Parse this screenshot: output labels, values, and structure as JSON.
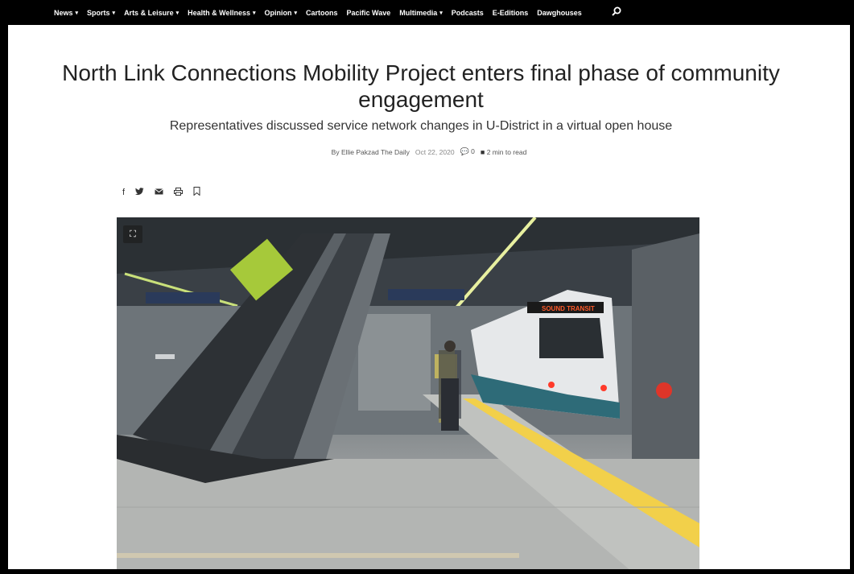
{
  "nav": {
    "items": [
      {
        "label": "News",
        "caret": true
      },
      {
        "label": "Sports",
        "caret": true
      },
      {
        "label": "Arts & Leisure",
        "caret": true
      },
      {
        "label": "Health & Wellness",
        "caret": true
      },
      {
        "label": "Opinion",
        "caret": true
      },
      {
        "label": "Cartoons",
        "caret": false
      },
      {
        "label": "Pacific Wave",
        "caret": false
      },
      {
        "label": "Multimedia",
        "caret": true
      },
      {
        "label": "Podcasts",
        "caret": false
      },
      {
        "label": "E-Editions",
        "caret": false
      },
      {
        "label": "Dawghouses",
        "caret": false
      }
    ],
    "search_icon": "search-icon"
  },
  "article": {
    "headline": "North Link Connections Mobility Project enters final phase of community engagement",
    "subhead": "Representatives discussed service network changes in U-District in a virtual open house",
    "byline_prefix": "By",
    "author": "Ellie Pakzad",
    "publication": "The Daily",
    "date": "Oct 22, 2020",
    "comment_count": "0",
    "read_time": "2 min to read"
  },
  "share": {
    "icons": [
      "facebook-icon",
      "twitter-icon",
      "email-icon",
      "print-icon",
      "bookmark-icon"
    ]
  },
  "hero": {
    "train_sign": "SOUND TRANSIT"
  },
  "colors": {
    "nav_bg": "#000000",
    "text": "#222222",
    "platform_stripe": "#f2d04a"
  }
}
